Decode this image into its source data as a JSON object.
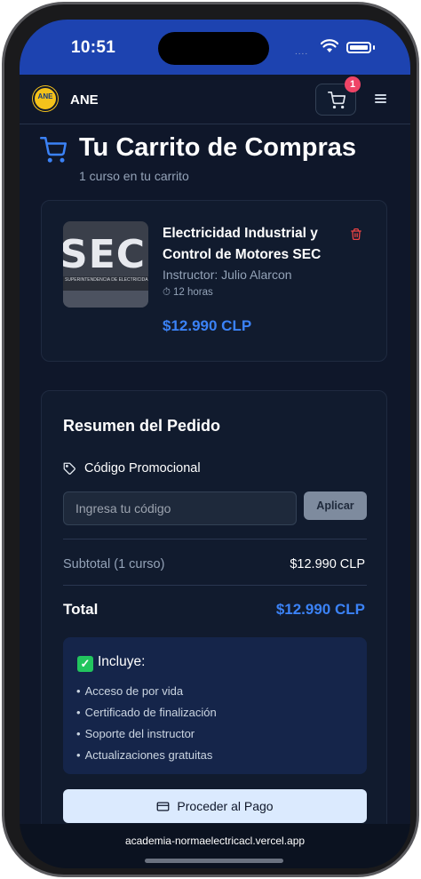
{
  "status": {
    "time": "10:51",
    "signal": "...."
  },
  "nav": {
    "logo_text": "ANE",
    "brand": "ANE",
    "cart_count": "1"
  },
  "header": {
    "title": "Tu Carrito de Compras",
    "subtitle": "1 curso en tu carrito"
  },
  "cart": {
    "items": [
      {
        "thumbnail_text_large": "SEC",
        "thumbnail_text_small": "SUPERINTENDENCIA DE ELECTRICIDAD Y COMBUSTIBLES",
        "title": "Electricidad Industrial y Control de Motores SEC",
        "instructor": "Instructor: Julio Alarcon",
        "duration": "12 horas",
        "price": "$12.990 CLP"
      }
    ]
  },
  "summary": {
    "title": "Resumen del Pedido",
    "promo_label": "Código Promocional",
    "promo_placeholder": "Ingresa tu código",
    "apply_label": "Aplicar",
    "subtotal_label": "Subtotal (1 curso)",
    "subtotal_value": "$12.990 CLP",
    "total_label": "Total",
    "total_value": "$12.990 CLP",
    "includes": {
      "title": "Incluye:",
      "items": [
        "Acceso de por vida",
        "Certificado de finalización",
        "Soporte del instructor",
        "Actualizaciones gratuitas"
      ]
    },
    "checkout_label": "Proceder al Pago"
  },
  "browser": {
    "url": "academia-normaelectricacl.vercel.app"
  },
  "colors": {
    "accent": "#3b82f6",
    "status_bar": "#1d43b0",
    "background": "#0f172a",
    "badge": "#ef4466",
    "delete": "#ef4444"
  }
}
